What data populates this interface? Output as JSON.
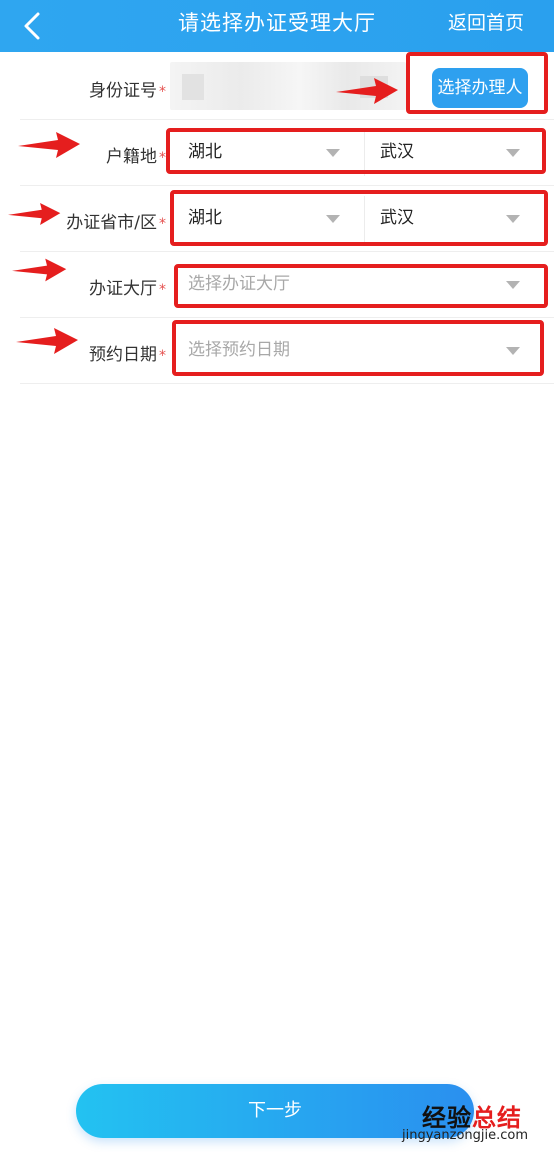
{
  "header": {
    "title": "请选择办证受理大厅",
    "home_label": "返回首页",
    "background": "#2aa0ee"
  },
  "form": {
    "id_number": {
      "label": "身份证号",
      "required_mark": "*",
      "button_label": "选择办理人"
    },
    "household": {
      "label": "户籍地",
      "required_mark": "*",
      "province": "湖北",
      "city": "武汉"
    },
    "office_city": {
      "label": "办证省市/区",
      "required_mark": "*",
      "province": "湖北",
      "city": "武汉"
    },
    "office_hall": {
      "label": "办证大厅",
      "required_mark": "*",
      "placeholder": "选择办证大厅"
    },
    "date": {
      "label": "预约日期",
      "required_mark": "*",
      "placeholder": "选择预约日期"
    }
  },
  "footer": {
    "next_label": "下一步"
  },
  "watermark": {
    "main_prefix": "经验",
    "main_suffix": "总结",
    "sub": "jingyanzongjie.com"
  },
  "colors": {
    "accent": "#2ea0ef",
    "annotation_red": "#e51e1e",
    "required_red": "#e5514f"
  }
}
